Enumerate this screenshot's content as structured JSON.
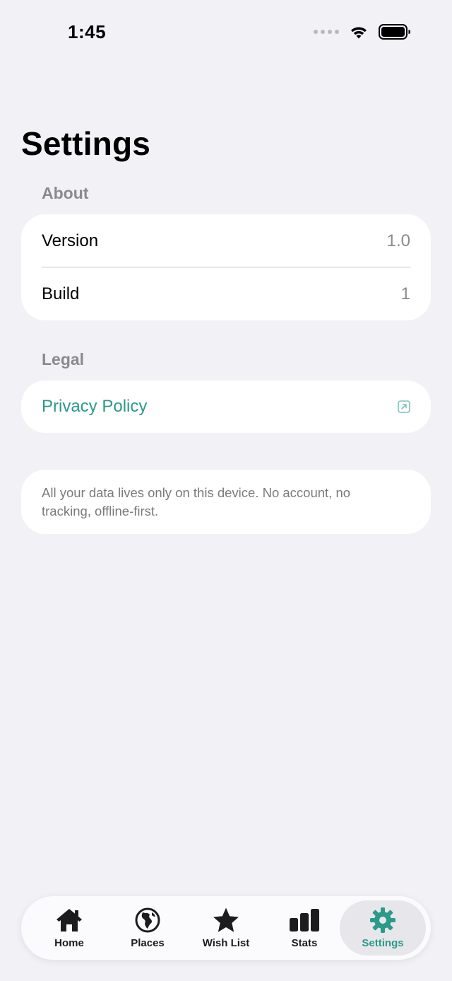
{
  "status_bar": {
    "time": "1:45"
  },
  "page": {
    "title": "Settings"
  },
  "about": {
    "header": "About",
    "rows": [
      {
        "label": "Version",
        "value": "1.0"
      },
      {
        "label": "Build",
        "value": "1"
      }
    ]
  },
  "legal": {
    "header": "Legal",
    "privacy_label": "Privacy Policy",
    "link_icon": "external-link-icon"
  },
  "info": {
    "text": "All your data lives only on this device. No account, no tracking, offline-first."
  },
  "tabbar": {
    "tabs": [
      {
        "label": "Home",
        "icon": "house-icon"
      },
      {
        "label": "Places",
        "icon": "globe-icon"
      },
      {
        "label": "Wish List",
        "icon": "star-icon"
      },
      {
        "label": "Stats",
        "icon": "bar-chart-icon"
      },
      {
        "label": "Settings",
        "icon": "gear-icon",
        "active": true
      }
    ]
  },
  "colors": {
    "accent": "#2a9a8a",
    "background": "#f1f1f6",
    "secondary_text": "#8a8a8e"
  }
}
